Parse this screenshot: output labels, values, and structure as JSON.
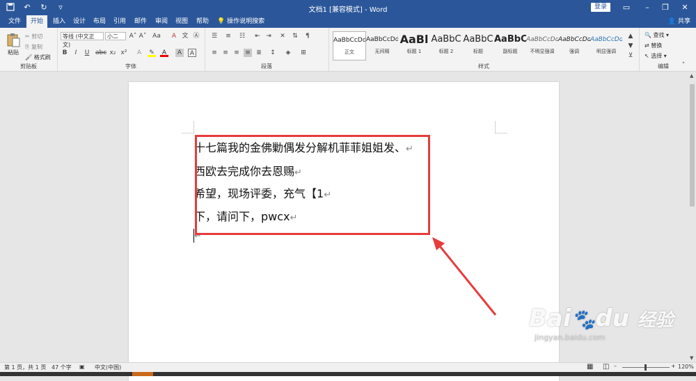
{
  "titlebar": {
    "title": "文档1 [兼容模式] - Word",
    "login": "登录",
    "qat_icons": [
      "save-icon",
      "undo-icon",
      "redo-icon",
      "customize-icon"
    ],
    "window_icons": [
      "ribbon-display-icon",
      "minimize-icon",
      "restore-icon",
      "close-icon"
    ]
  },
  "tabs": [
    "文件",
    "开始",
    "插入",
    "设计",
    "布局",
    "引用",
    "邮件",
    "审阅",
    "视图",
    "帮助"
  ],
  "tell_me": "操作说明搜索",
  "share": "共享",
  "ribbon": {
    "clipboard": {
      "paste": "粘贴",
      "cut": "剪切",
      "copy": "复制",
      "format_painter": "格式刷",
      "label": "剪贴板"
    },
    "font": {
      "name": "等线 (中文正文)",
      "size": "小二",
      "aa": "Aa",
      "label": "字体",
      "buttons": [
        "B",
        "I",
        "U",
        "abc",
        "x₂",
        "x²"
      ]
    },
    "paragraph": {
      "label": "段落"
    },
    "styles": {
      "label": "样式",
      "items": [
        {
          "preview": "AaBbCcDd",
          "name": "正文"
        },
        {
          "preview": "AaBbCcDd",
          "name": "无间隔"
        },
        {
          "preview": "AaBl",
          "name": "标题 1"
        },
        {
          "preview": "AaBbC",
          "name": "标题 2"
        },
        {
          "preview": "AaBbC",
          "name": "标题"
        },
        {
          "preview": "AaBbC",
          "name": "副标题"
        },
        {
          "preview": "AaBbCcDd",
          "name": "不明显强调"
        },
        {
          "preview": "AaBbCcDd",
          "name": "强调"
        },
        {
          "preview": "AaBbCcDd",
          "name": "明显强调"
        }
      ]
    },
    "editing": {
      "find": "查找",
      "replace": "替换",
      "select": "选择",
      "label": "编辑"
    }
  },
  "document": {
    "lines": [
      "十七篇我的金佛勦偶发分解机菲菲姐姐发、",
      "西欧去完成你去恩赐",
      "希望，现场评委，充气【1",
      "下，请问下，pwcx"
    ],
    "para_mark": "↵"
  },
  "status": {
    "page": "第 1 页，共 1 页",
    "words": "47 个字",
    "lang": "中文(中国)",
    "zoom": "120%"
  },
  "watermark": {
    "brand": "Bai",
    "brand2": "du",
    "cn": "经验",
    "url": "jingyan.baidu.com"
  },
  "colors": {
    "accent": "#2b579a",
    "highlight": "#e83b3b"
  }
}
